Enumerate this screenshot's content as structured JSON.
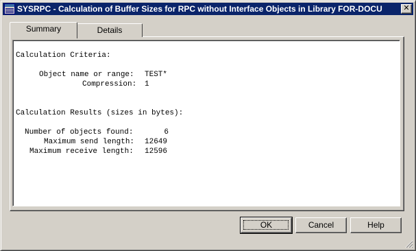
{
  "window": {
    "title": "SYSRPC - Calculation of Buffer Sizes for RPC without Interface Objects in Library FOR-DOCU",
    "close_symbol": "✕"
  },
  "tabs": [
    {
      "label": "Summary",
      "active": true
    },
    {
      "label": "Details",
      "active": false
    }
  ],
  "summary": {
    "criteria_heading": "Calculation Criteria:",
    "object_name_label": "Object name or range:",
    "object_name_value": "TEST*",
    "compression_label": "Compression:",
    "compression_value": "1",
    "results_heading": "Calculation Results (sizes in bytes):",
    "objects_found_label": "Number of objects found:",
    "objects_found_value": "6",
    "max_send_label": "Maximum send length:",
    "max_send_value": "12649",
    "max_receive_label": "Maximum receive length:",
    "max_receive_value": "12596"
  },
  "buttons": {
    "ok": "OK",
    "cancel": "Cancel",
    "help": "Help"
  },
  "colors": {
    "titlebar": "#0a246a",
    "dialog_face": "#d4d0c8",
    "content_bg": "#ffffff"
  },
  "icons": {
    "title": "app-window-icon",
    "close": "close-icon",
    "grip": "resize-grip-icon"
  }
}
